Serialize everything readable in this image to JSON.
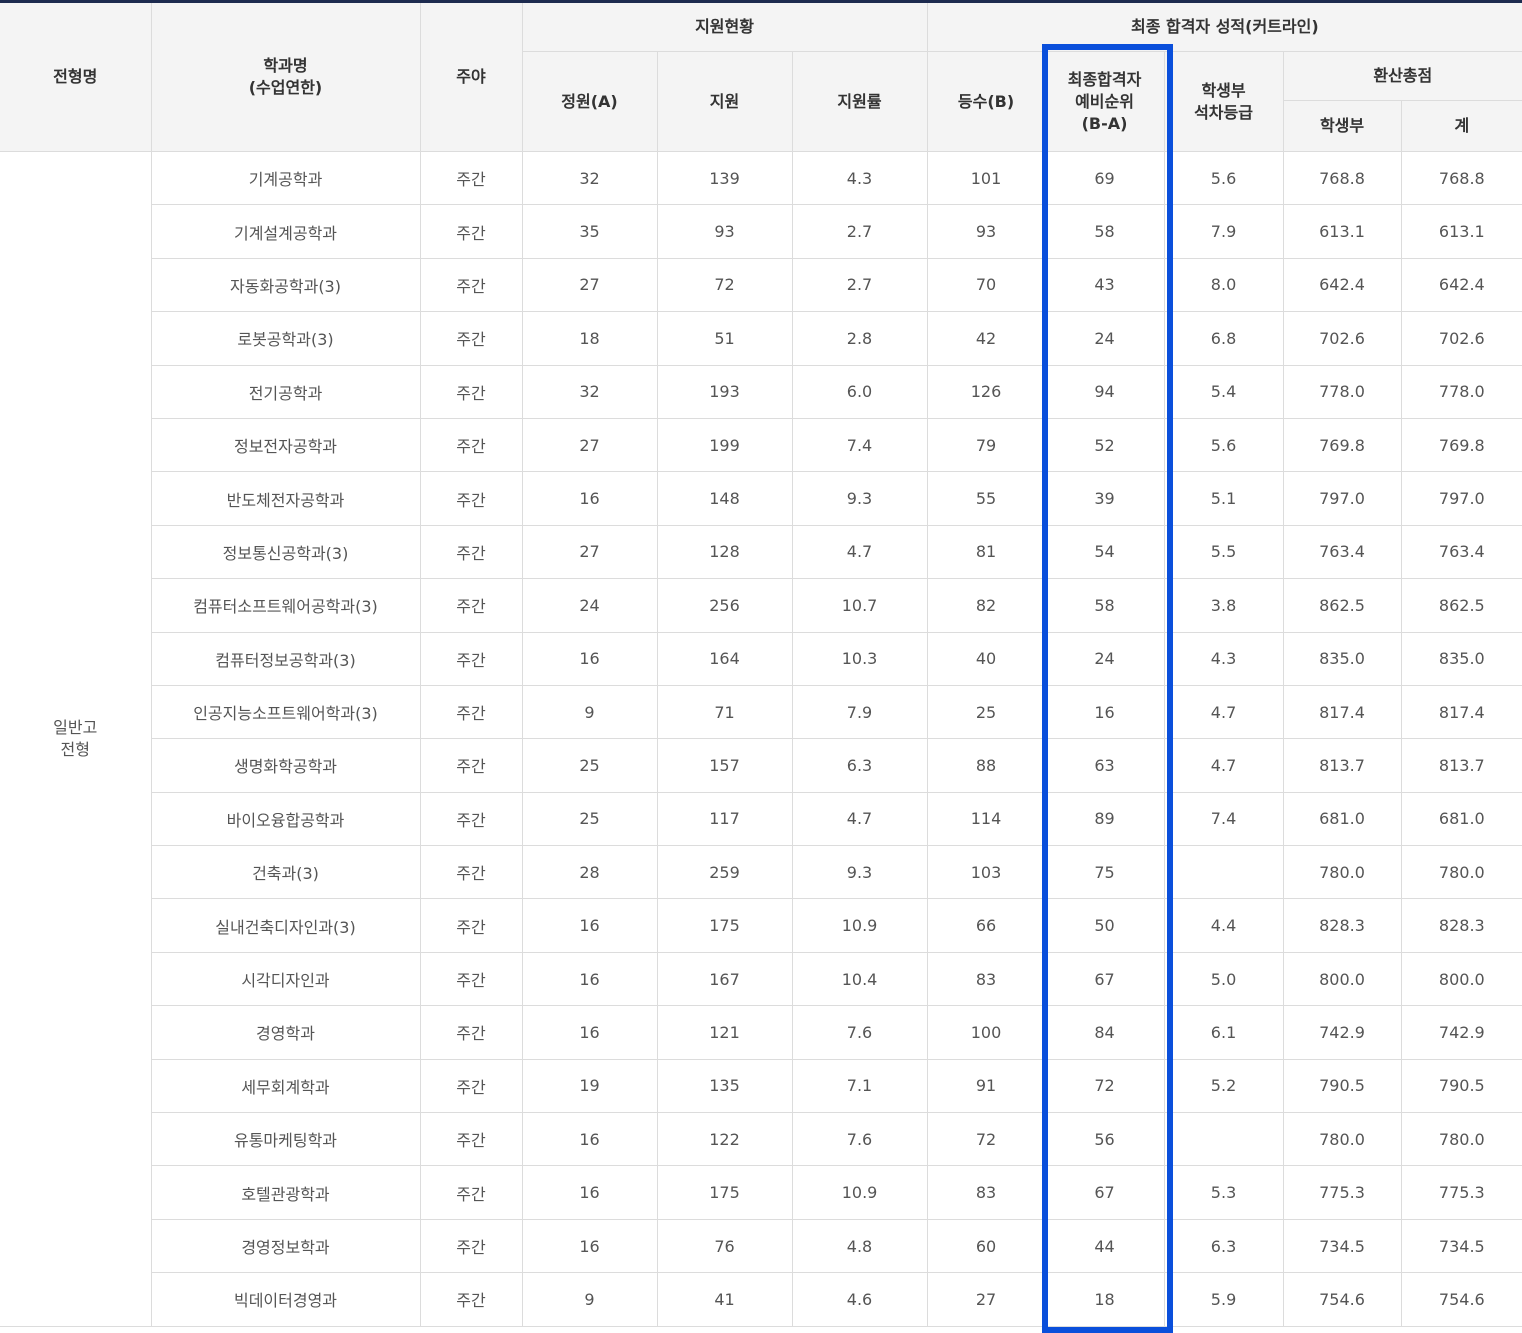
{
  "header": {
    "type_name": "전형명",
    "dept_line1": "학과명",
    "dept_line2": "(수업연한)",
    "day_night": "주야",
    "applicants_group": "지원현황",
    "final_group": "최종 합격자 성적(커트라인)",
    "quota": "정원(A)",
    "applied": "지원",
    "ratio": "지원률",
    "rank": "등수(B)",
    "reserve_line1": "최종합격자",
    "reserve_line2": "예비순위",
    "reserve_line3": "(B-A)",
    "grade_line1": "학생부",
    "grade_line2": "석차등급",
    "score_group": "환산총점",
    "score_record": "학생부",
    "score_total": "계"
  },
  "admission_type_line1": "일반고",
  "admission_type_line2": "전형",
  "rows": [
    {
      "dept": "기계공학과",
      "time": "주간",
      "quota": "32",
      "applied": "139",
      "ratio": "4.3",
      "rank": "101",
      "reserve": "69",
      "grade": "5.6",
      "score": "768.8",
      "total": "768.8"
    },
    {
      "dept": "기계설계공학과",
      "time": "주간",
      "quota": "35",
      "applied": "93",
      "ratio": "2.7",
      "rank": "93",
      "reserve": "58",
      "grade": "7.9",
      "score": "613.1",
      "total": "613.1"
    },
    {
      "dept": "자동화공학과(3)",
      "time": "주간",
      "quota": "27",
      "applied": "72",
      "ratio": "2.7",
      "rank": "70",
      "reserve": "43",
      "grade": "8.0",
      "score": "642.4",
      "total": "642.4"
    },
    {
      "dept": "로봇공학과(3)",
      "time": "주간",
      "quota": "18",
      "applied": "51",
      "ratio": "2.8",
      "rank": "42",
      "reserve": "24",
      "grade": "6.8",
      "score": "702.6",
      "total": "702.6"
    },
    {
      "dept": "전기공학과",
      "time": "주간",
      "quota": "32",
      "applied": "193",
      "ratio": "6.0",
      "rank": "126",
      "reserve": "94",
      "grade": "5.4",
      "score": "778.0",
      "total": "778.0"
    },
    {
      "dept": "정보전자공학과",
      "time": "주간",
      "quota": "27",
      "applied": "199",
      "ratio": "7.4",
      "rank": "79",
      "reserve": "52",
      "grade": "5.6",
      "score": "769.8",
      "total": "769.8"
    },
    {
      "dept": "반도체전자공학과",
      "time": "주간",
      "quota": "16",
      "applied": "148",
      "ratio": "9.3",
      "rank": "55",
      "reserve": "39",
      "grade": "5.1",
      "score": "797.0",
      "total": "797.0"
    },
    {
      "dept": "정보통신공학과(3)",
      "time": "주간",
      "quota": "27",
      "applied": "128",
      "ratio": "4.7",
      "rank": "81",
      "reserve": "54",
      "grade": "5.5",
      "score": "763.4",
      "total": "763.4"
    },
    {
      "dept": "컴퓨터소프트웨어공학과(3)",
      "time": "주간",
      "quota": "24",
      "applied": "256",
      "ratio": "10.7",
      "rank": "82",
      "reserve": "58",
      "grade": "3.8",
      "score": "862.5",
      "total": "862.5"
    },
    {
      "dept": "컴퓨터정보공학과(3)",
      "time": "주간",
      "quota": "16",
      "applied": "164",
      "ratio": "10.3",
      "rank": "40",
      "reserve": "24",
      "grade": "4.3",
      "score": "835.0",
      "total": "835.0"
    },
    {
      "dept": "인공지능소프트웨어학과(3)",
      "time": "주간",
      "quota": "9",
      "applied": "71",
      "ratio": "7.9",
      "rank": "25",
      "reserve": "16",
      "grade": "4.7",
      "score": "817.4",
      "total": "817.4"
    },
    {
      "dept": "생명화학공학과",
      "time": "주간",
      "quota": "25",
      "applied": "157",
      "ratio": "6.3",
      "rank": "88",
      "reserve": "63",
      "grade": "4.7",
      "score": "813.7",
      "total": "813.7"
    },
    {
      "dept": "바이오융합공학과",
      "time": "주간",
      "quota": "25",
      "applied": "117",
      "ratio": "4.7",
      "rank": "114",
      "reserve": "89",
      "grade": "7.4",
      "score": "681.0",
      "total": "681.0"
    },
    {
      "dept": "건축과(3)",
      "time": "주간",
      "quota": "28",
      "applied": "259",
      "ratio": "9.3",
      "rank": "103",
      "reserve": "75",
      "grade": "",
      "score": "780.0",
      "total": "780.0"
    },
    {
      "dept": "실내건축디자인과(3)",
      "time": "주간",
      "quota": "16",
      "applied": "175",
      "ratio": "10.9",
      "rank": "66",
      "reserve": "50",
      "grade": "4.4",
      "score": "828.3",
      "total": "828.3"
    },
    {
      "dept": "시각디자인과",
      "time": "주간",
      "quota": "16",
      "applied": "167",
      "ratio": "10.4",
      "rank": "83",
      "reserve": "67",
      "grade": "5.0",
      "score": "800.0",
      "total": "800.0"
    },
    {
      "dept": "경영학과",
      "time": "주간",
      "quota": "16",
      "applied": "121",
      "ratio": "7.6",
      "rank": "100",
      "reserve": "84",
      "grade": "6.1",
      "score": "742.9",
      "total": "742.9"
    },
    {
      "dept": "세무회계학과",
      "time": "주간",
      "quota": "19",
      "applied": "135",
      "ratio": "7.1",
      "rank": "91",
      "reserve": "72",
      "grade": "5.2",
      "score": "790.5",
      "total": "790.5"
    },
    {
      "dept": "유통마케팅학과",
      "time": "주간",
      "quota": "16",
      "applied": "122",
      "ratio": "7.6",
      "rank": "72",
      "reserve": "56",
      "grade": "",
      "score": "780.0",
      "total": "780.0"
    },
    {
      "dept": "호텔관광학과",
      "time": "주간",
      "quota": "16",
      "applied": "175",
      "ratio": "10.9",
      "rank": "83",
      "reserve": "67",
      "grade": "5.3",
      "score": "775.3",
      "total": "775.3"
    },
    {
      "dept": "경영정보학과",
      "time": "주간",
      "quota": "16",
      "applied": "76",
      "ratio": "4.8",
      "rank": "60",
      "reserve": "44",
      "grade": "6.3",
      "score": "734.5",
      "total": "734.5"
    },
    {
      "dept": "빅데이터경영과",
      "time": "주간",
      "quota": "9",
      "applied": "41",
      "ratio": "4.6",
      "rank": "27",
      "reserve": "18",
      "grade": "5.9",
      "score": "754.6",
      "total": "754.6"
    }
  ],
  "colors": {
    "highlight": "#0a4fdb",
    "header_bg": "#f4f4f4",
    "top_border": "#1d2b4f"
  }
}
